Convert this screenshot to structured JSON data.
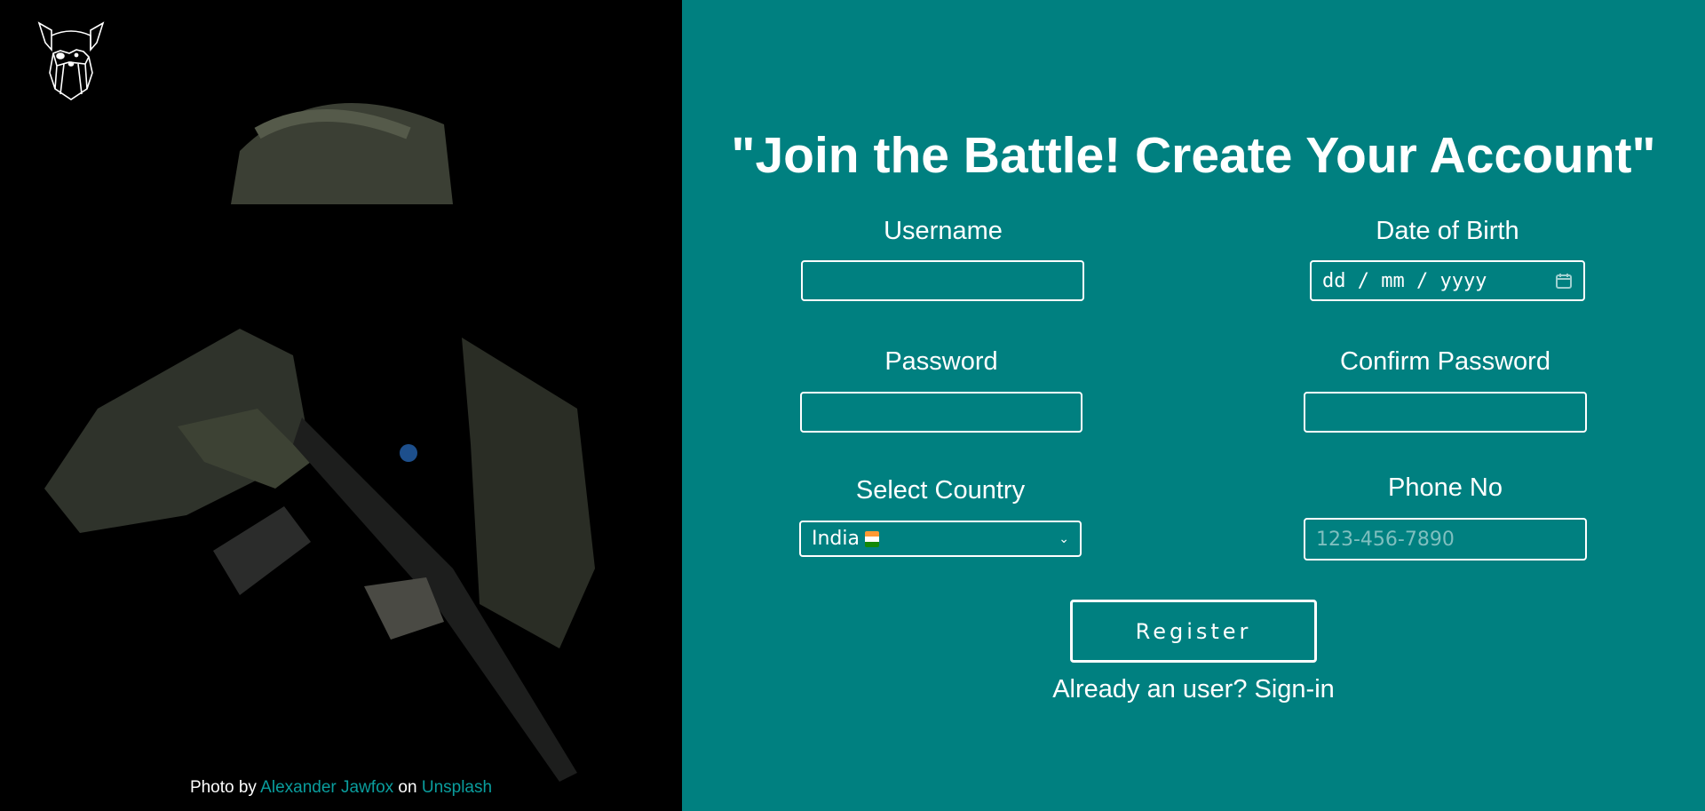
{
  "title": "\"Join the Battle! Create Your Account\"",
  "form": {
    "username_label": "Username",
    "username_value": "",
    "dob_label": "Date of Birth",
    "dob_placeholder": "dd / mm / yyyy",
    "password_label": "Password",
    "password_value": "",
    "confirm_label": "Confirm Password",
    "confirm_value": "",
    "country_label": "Select Country",
    "country_value": "India",
    "phone_label": "Phone No",
    "phone_placeholder": "123-456-7890",
    "register_label": "Register",
    "signin_text": "Already an user? Sign-in"
  },
  "credit": {
    "prefix": "Photo by",
    "author": "Alexander Jawfox",
    "mid": "on",
    "site": "Unsplash"
  },
  "colors": {
    "panel": "#008080",
    "left": "#000000",
    "link": "#0a9d9d"
  }
}
